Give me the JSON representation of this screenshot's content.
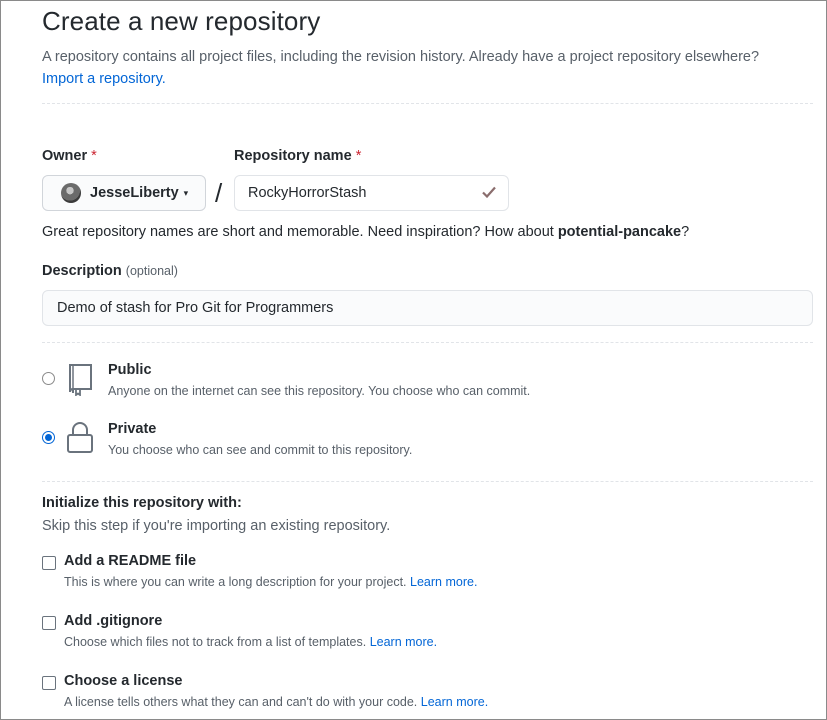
{
  "page": {
    "title": "Create a new repository",
    "subhead_text": "A repository contains all project files, including the revision history. Already have a project repository elsewhere?",
    "import_link": "Import a repository."
  },
  "owner": {
    "label": "Owner",
    "required_mark": "*",
    "name": "JesseLiberty",
    "caret": "▾"
  },
  "separator": "/",
  "repo_name": {
    "label": "Repository name",
    "required_mark": "*",
    "value": "RockyHorrorStash",
    "valid_icon": "check-icon"
  },
  "name_hint": {
    "text": "Great repository names are short and memorable. Need inspiration? How about",
    "suggestion": "potential-pancake",
    "end": "?"
  },
  "description": {
    "label": "Description",
    "optional": "(optional)",
    "value": "Demo of stash for Pro Git for Programmers"
  },
  "visibility": [
    {
      "title": "Public",
      "desc": "Anyone on the internet can see this repository. You choose who can commit.",
      "checked": false,
      "icon": "repo-icon"
    },
    {
      "title": "Private",
      "desc": "You choose who can see and commit to this repository.",
      "checked": true,
      "icon": "lock-icon"
    }
  ],
  "init": {
    "title": "Initialize this repository with:",
    "subtitle": "Skip this step if you're importing an existing repository.",
    "options": [
      {
        "title": "Add a README file",
        "desc": "This is where you can write a long description for your project.",
        "link": "Learn more.",
        "checked": false
      },
      {
        "title": "Add .gitignore",
        "desc": "Choose which files not to track from a list of templates.",
        "link": "Learn more.",
        "checked": false
      },
      {
        "title": "Choose a license",
        "desc": "A license tells others what they can and can't do with your code.",
        "link": "Learn more.",
        "checked": false
      }
    ]
  },
  "colors": {
    "link": "#0366d6",
    "required": "#cb2431",
    "muted": "#586069"
  }
}
